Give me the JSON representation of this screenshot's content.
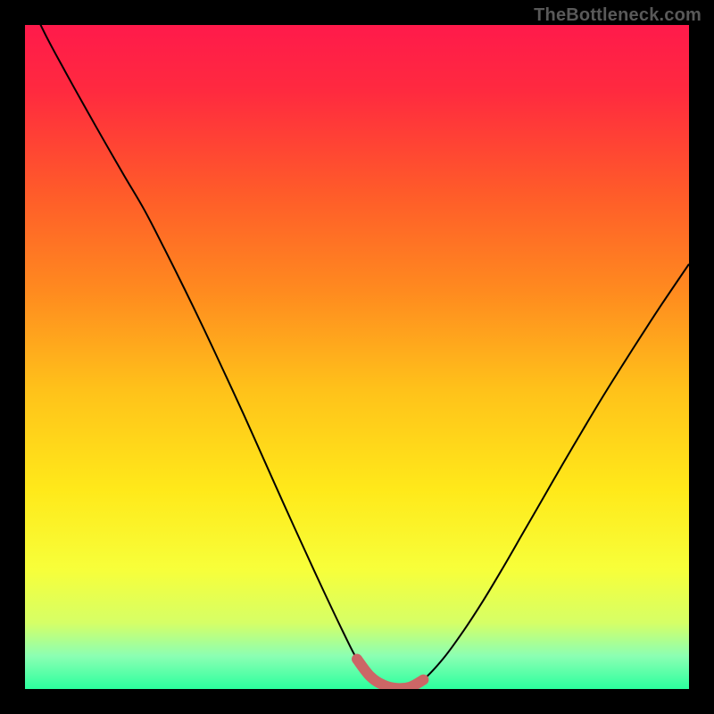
{
  "watermark": "TheBottleneck.com",
  "colors": {
    "frame": "#000000",
    "curve_stroke": "#000000",
    "highlight_stroke": "#cc6666",
    "gradient_stops": [
      {
        "offset": 0.0,
        "color": "#ff1a4b"
      },
      {
        "offset": 0.1,
        "color": "#ff2a3f"
      },
      {
        "offset": 0.25,
        "color": "#ff5a2a"
      },
      {
        "offset": 0.4,
        "color": "#ff8a1f"
      },
      {
        "offset": 0.55,
        "color": "#ffc21a"
      },
      {
        "offset": 0.7,
        "color": "#ffe91a"
      },
      {
        "offset": 0.82,
        "color": "#f7ff3a"
      },
      {
        "offset": 0.9,
        "color": "#d6ff66"
      },
      {
        "offset": 0.95,
        "color": "#8cffb3"
      },
      {
        "offset": 1.0,
        "color": "#2bff9e"
      }
    ]
  },
  "chart_data": {
    "type": "line",
    "title": "",
    "xlabel": "",
    "ylabel": "",
    "xlim": [
      0,
      100
    ],
    "ylim": [
      0,
      100
    ],
    "grid": false,
    "legend": false,
    "x": [
      0,
      3,
      6,
      9,
      12,
      15,
      18,
      21,
      24,
      27,
      30,
      33,
      36,
      39,
      42,
      45,
      48,
      50,
      52,
      54,
      56,
      58,
      60,
      63,
      66,
      69,
      72,
      75,
      78,
      81,
      84,
      87,
      90,
      93,
      96,
      100
    ],
    "series": [
      {
        "name": "bottleneck-curve",
        "values": [
          105,
          98.7,
          93.1,
          87.7,
          82.4,
          77.2,
          72.1,
          66.3,
          60.3,
          54.1,
          47.7,
          41.2,
          34.5,
          27.8,
          21.2,
          14.7,
          8.4,
          4.5,
          1.9,
          0.6,
          0.1,
          0.3,
          1.4,
          4.6,
          8.7,
          13.3,
          18.3,
          23.5,
          28.7,
          33.9,
          39.0,
          44.0,
          48.8,
          53.5,
          58.1,
          64.0
        ]
      }
    ],
    "highlight": {
      "name": "flat-bottom-highlight",
      "x_range": [
        50,
        60
      ],
      "note": "thick coral segment at curve minimum"
    }
  }
}
